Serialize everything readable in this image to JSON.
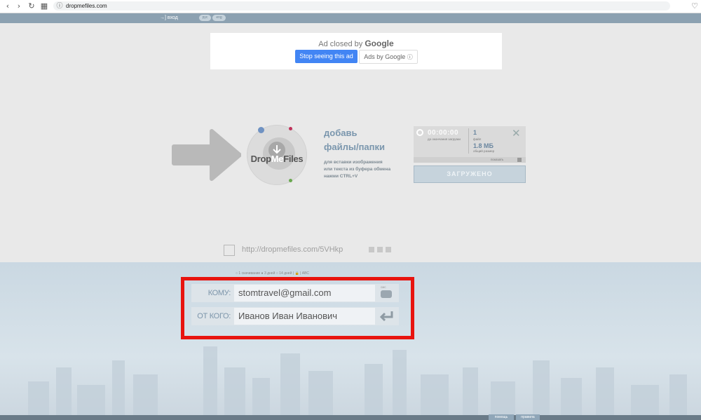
{
  "browser": {
    "url": "dropmefiles.com",
    "nav_icons": [
      "back-icon",
      "forward-icon",
      "reload-icon",
      "apps-icon",
      "site-info-icon",
      "bookmark-icon"
    ]
  },
  "header": {
    "login_label": "→] вход",
    "languages": [
      "рус",
      "eng"
    ]
  },
  "ad": {
    "closed_prefix": "Ad closed by",
    "closed_brand": "Google",
    "stop_label": "Stop seeing this ad",
    "ads_by_label": "Ads by Google"
  },
  "upload": {
    "logo_drop": "Drop",
    "logo_me": "Me",
    "logo_files": "Files",
    "title_line1": "добавь",
    "title_line2": "файлы/папки",
    "hint_line1": "для вставки изображения",
    "hint_line2": "или текста из буфера обмена",
    "hint_line3": "нажми CTRL+V"
  },
  "status": {
    "timer": "00:00:00",
    "timer_label": "до окончания загрузки",
    "file_count": "1",
    "file_label": "файл",
    "total_size": "1.8 МБ",
    "size_label": "общий размер",
    "show_label": "показать",
    "uploaded_label": "ЗАГРУЖЕНО"
  },
  "share": {
    "link": "http://dropmefiles.com/5VHkp"
  },
  "options": {
    "text": "○ 1 скачивание  ● 3 дней  ○ 14 дней  |  🔒  |  ABC"
  },
  "form": {
    "to_label": "КОМУ:",
    "to_value": "stomtravel@gmail.com",
    "from_label": "ОТ КОГО:",
    "from_value": "Иванов Иван Иванович",
    "sms_label": "смс"
  },
  "footer": {
    "links": [
      "помощь",
      "правила"
    ]
  },
  "colors": {
    "highlight": "#e8140f",
    "accent": "#7a96ad",
    "google_blue": "#4285f4"
  }
}
